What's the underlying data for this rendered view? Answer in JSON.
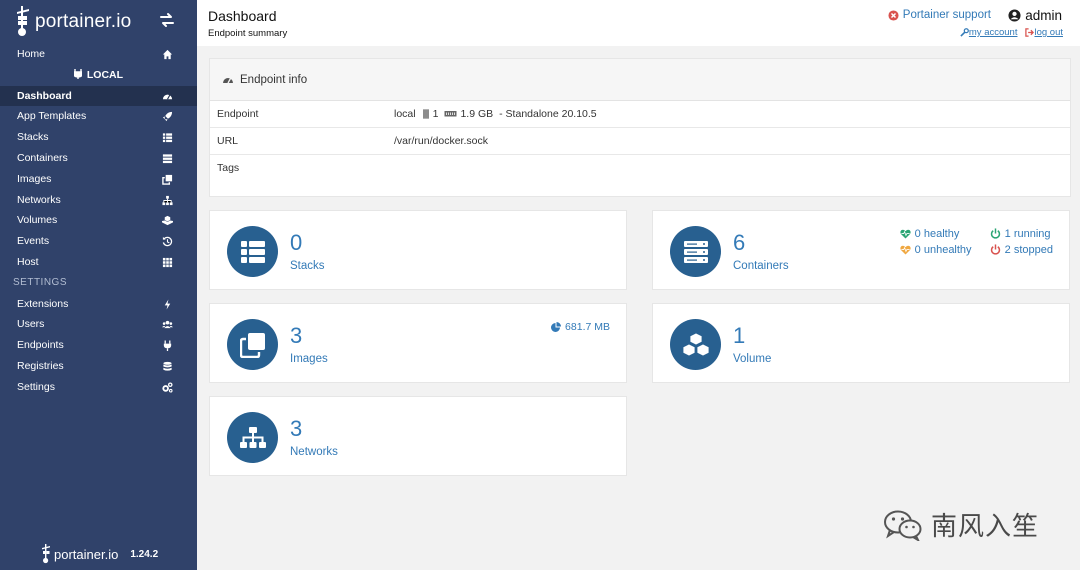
{
  "sidebar": {
    "brand": "portainer.io",
    "items": [
      {
        "label": "Home",
        "icon": "home-icon"
      },
      {
        "label": "Dashboard",
        "icon": "tachometer-icon"
      },
      {
        "label": "App Templates",
        "icon": "rocket-icon"
      },
      {
        "label": "Stacks",
        "icon": "th-list-icon"
      },
      {
        "label": "Containers",
        "icon": "server-icon"
      },
      {
        "label": "Images",
        "icon": "clone-icon"
      },
      {
        "label": "Networks",
        "icon": "sitemap-icon"
      },
      {
        "label": "Volumes",
        "icon": "cubes-icon"
      },
      {
        "label": "Events",
        "icon": "history-icon"
      },
      {
        "label": "Host",
        "icon": "th-icon"
      },
      {
        "label": "Extensions",
        "icon": "bolt-icon"
      },
      {
        "label": "Users",
        "icon": "users-icon"
      },
      {
        "label": "Endpoints",
        "icon": "plug-icon"
      },
      {
        "label": "Registries",
        "icon": "database-icon"
      },
      {
        "label": "Settings",
        "icon": "cogs-icon"
      }
    ],
    "endpoint_label": "LOCAL",
    "settings_section": "SETTINGS",
    "footer_brand": "portainer.io",
    "version": "1.24.2"
  },
  "header": {
    "title": "Dashboard",
    "subtitle": "Endpoint summary",
    "support": "Portainer support",
    "user": "admin",
    "my_account": "my account",
    "log_out": "log out"
  },
  "endpoint_info": {
    "title": "Endpoint info",
    "rows": [
      {
        "key": "Endpoint",
        "name": "local",
        "cpu": "1",
        "memory": "1.9 GB",
        "mode": "- Standalone 20.10.5"
      },
      {
        "key": "URL",
        "value": "/var/run/docker.sock"
      },
      {
        "key": "Tags",
        "value": ""
      }
    ]
  },
  "tiles": {
    "stacks": {
      "count": "0",
      "label": "Stacks"
    },
    "containers": {
      "count": "6",
      "label": "Containers",
      "healthy": "0 healthy",
      "unhealthy": "0 unhealthy",
      "running": "1 running",
      "stopped": "2 stopped"
    },
    "images": {
      "count": "3",
      "label": "Images",
      "size": "681.7 MB"
    },
    "volume": {
      "count": "1",
      "label": "Volume"
    },
    "networks": {
      "count": "3",
      "label": "Networks"
    }
  },
  "watermark": "南风入笙",
  "colors": {
    "sidebar": "#30426a",
    "sidebar_active": "#23314f",
    "accent": "#337ab7",
    "tile_icon": "#286090",
    "healthy": "#2ba574",
    "unhealthy": "#f0a841",
    "stopped": "#d9534f"
  }
}
